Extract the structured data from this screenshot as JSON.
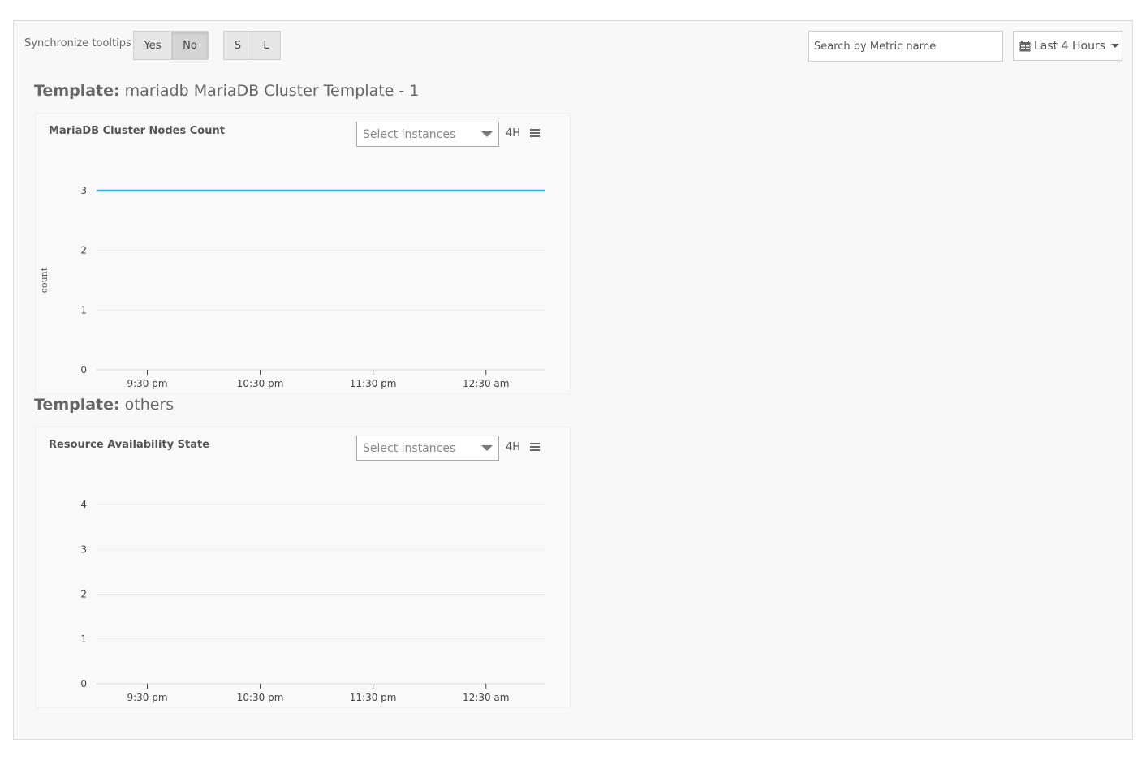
{
  "toolbar": {
    "sync_label": "Synchronize tooltips",
    "yes_label": "Yes",
    "no_label": "No",
    "size_s_label": "S",
    "size_l_label": "L",
    "search_placeholder": "Search by Metric name",
    "time_range_label": "Last 4 Hours",
    "time_range_icon": "calendar-icon"
  },
  "templates": [
    {
      "title_prefix": "Template:",
      "title_name": "mariadb MariaDB Cluster Template - 1",
      "card": {
        "title": "MariaDB Cluster Nodes Count",
        "select_placeholder": "Select instances",
        "range_tag": "4H",
        "menu_icon": "list-icon"
      }
    },
    {
      "title_prefix": "Template:",
      "title_name": "others",
      "card": {
        "title": "Resource Availability State",
        "select_placeholder": "Select instances",
        "range_tag": "4H",
        "menu_icon": "list-icon"
      }
    }
  ],
  "chart_data": [
    {
      "type": "line",
      "title": "MariaDB Cluster Nodes Count",
      "ylabel": "count",
      "xlabel": "",
      "x_ticks": [
        "9:30 pm",
        "10:30 pm",
        "11:30 pm",
        "12:30 am"
      ],
      "y_ticks": [
        0,
        1,
        2,
        3
      ],
      "ylim": [
        0,
        3
      ],
      "series": [
        {
          "color": "#29b6e0",
          "values": [
            3,
            3,
            3,
            3,
            3,
            3,
            3,
            3
          ]
        }
      ],
      "grid": true
    },
    {
      "type": "line",
      "title": "Resource Availability State",
      "ylabel": "",
      "xlabel": "",
      "x_ticks": [
        "9:30 pm",
        "10:30 pm",
        "11:30 pm",
        "12:30 am"
      ],
      "y_ticks": [
        0,
        1,
        2,
        3,
        4
      ],
      "ylim": [
        0,
        4
      ],
      "series": [],
      "grid": true
    }
  ]
}
